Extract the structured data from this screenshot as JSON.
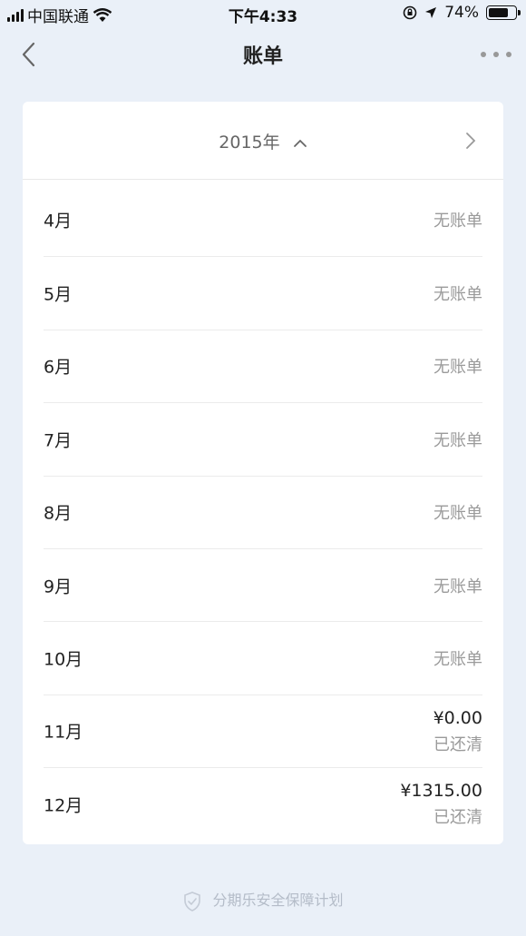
{
  "status_bar": {
    "carrier": "中国联通",
    "time": "下午4:33",
    "battery": "74%",
    "battery_level": 0.74
  },
  "nav": {
    "title": "账单"
  },
  "year_selector": {
    "year": "2015年"
  },
  "months": [
    {
      "month": "4月",
      "status": "无账单"
    },
    {
      "month": "5月",
      "status": "无账单"
    },
    {
      "month": "6月",
      "status": "无账单"
    },
    {
      "month": "7月",
      "status": "无账单"
    },
    {
      "month": "8月",
      "status": "无账单"
    },
    {
      "month": "9月",
      "status": "无账单"
    },
    {
      "month": "10月",
      "status": "无账单"
    },
    {
      "month": "11月",
      "amount": "¥0.00",
      "status": "已还清"
    },
    {
      "month": "12月",
      "amount": "¥1315.00",
      "status": "已还清"
    }
  ],
  "footer": {
    "text": "分期乐安全保障计划"
  },
  "colors": {
    "background": "#eaf0f8",
    "card": "#ffffff",
    "muted": "#9a9a9a"
  }
}
